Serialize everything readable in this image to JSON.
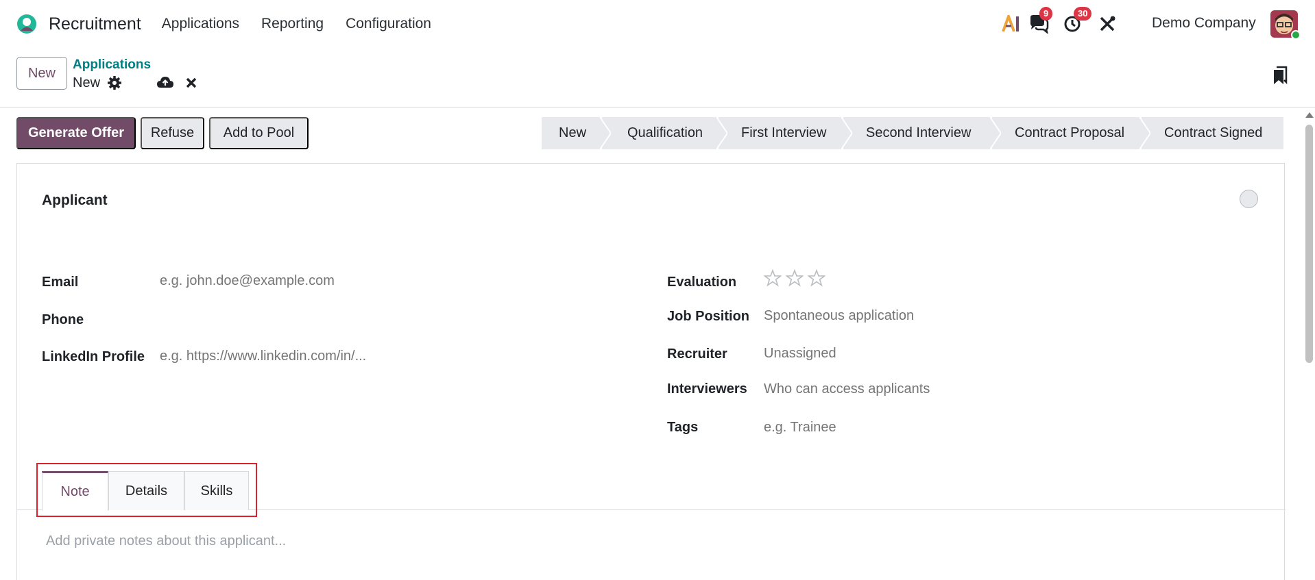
{
  "navbar": {
    "app_name": "Recruitment",
    "menu": [
      "Applications",
      "Reporting",
      "Configuration"
    ],
    "ai_label": "AI",
    "messages_count": "9",
    "activities_count": "30",
    "company": "Demo Company"
  },
  "control_panel": {
    "new_button": "New",
    "breadcrumb_parent": "Applications",
    "breadcrumb_current": "New"
  },
  "actions": {
    "generate_offer": "Generate Offer",
    "refuse": "Refuse",
    "add_to_pool": "Add to Pool"
  },
  "stages": [
    "New",
    "Qualification",
    "First Interview",
    "Second Interview",
    "Contract Proposal",
    "Contract Signed"
  ],
  "form": {
    "applicant_label": "Applicant",
    "email_label": "Email",
    "email_placeholder": "e.g. john.doe@example.com",
    "phone_label": "Phone",
    "linkedin_label": "LinkedIn Profile",
    "linkedin_placeholder": "e.g. https://www.linkedin.com/in/...",
    "evaluation_label": "Evaluation",
    "evaluation_value": 0,
    "job_position_label": "Job Position",
    "job_position_placeholder": "Spontaneous application",
    "recruiter_label": "Recruiter",
    "recruiter_placeholder": "Unassigned",
    "interviewers_label": "Interviewers",
    "interviewers_placeholder": "Who can access applicants",
    "tags_label": "Tags",
    "tags_placeholder": "e.g. Trainee"
  },
  "tabs": [
    "Note",
    "Details",
    "Skills"
  ],
  "note_placeholder": "Add private notes about this applicant...",
  "colors": {
    "brand": "#714b67",
    "link": "#017e84",
    "badge": "#dc3545",
    "highlight": "#d8232a"
  }
}
